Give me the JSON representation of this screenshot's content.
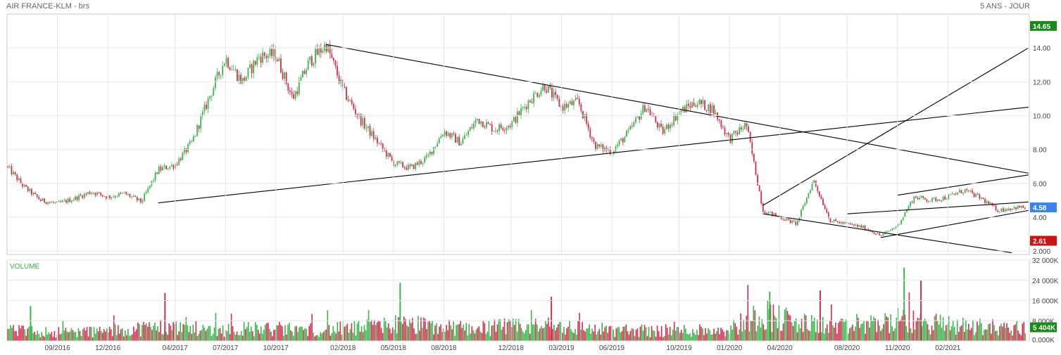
{
  "header": {
    "title": "AIR FRANCE-KLM - brs",
    "period": "5 ANS - JOUR"
  },
  "colors": {
    "up": "#3cb44b",
    "down": "#d03050",
    "high_badge": "#1a8a1a",
    "last_badge": "#3c82f0",
    "low_badge": "#cc1414",
    "vol_badge": "#1a8a1a",
    "grid": "#e6e6e6",
    "trendline": "#000000"
  },
  "chart_data": [
    {
      "type": "candlestick",
      "title": "AIR FRANCE-KLM - brs",
      "x_ticks": [
        "09/2016",
        "12/2016",
        "04/2017",
        "07/2017",
        "10/2017",
        "02/2018",
        "05/2018",
        "08/2018",
        "12/2018",
        "03/2019",
        "06/2019",
        "10/2019",
        "01/2020",
        "04/2020",
        "08/2020",
        "11/2020",
        "02/2021"
      ],
      "y_ticks": [
        "2.000",
        "4.00",
        "6.00",
        "8.00",
        "10.00",
        "12.00",
        "14.00"
      ],
      "ylim": [
        1.8,
        16.0
      ],
      "grid": true,
      "badges": {
        "high": "14.65",
        "last": "4.58",
        "low": "2.61"
      },
      "price_path": [
        [
          "2016-06",
          7.0
        ],
        [
          "2016-07",
          5.8
        ],
        [
          "2016-08",
          5.0
        ],
        [
          "2016-09",
          4.8
        ],
        [
          "2016-10",
          5.1
        ],
        [
          "2016-11",
          5.5
        ],
        [
          "2016-12",
          5.2
        ],
        [
          "2017-01",
          5.4
        ],
        [
          "2017-02",
          4.9
        ],
        [
          "2017-03",
          6.8
        ],
        [
          "2017-04",
          7.1
        ],
        [
          "2017-05",
          8.4
        ],
        [
          "2017-06",
          11.0
        ],
        [
          "2017-07",
          13.4
        ],
        [
          "2017-08",
          12.0
        ],
        [
          "2017-09",
          13.5
        ],
        [
          "2017-10",
          13.6
        ],
        [
          "2017-11",
          11.0
        ],
        [
          "2017-12",
          13.2
        ],
        [
          "2018-01",
          14.2
        ],
        [
          "2018-02",
          11.5
        ],
        [
          "2018-03",
          9.8
        ],
        [
          "2018-04",
          8.5
        ],
        [
          "2018-05",
          7.2
        ],
        [
          "2018-06",
          6.9
        ],
        [
          "2018-07",
          7.5
        ],
        [
          "2018-08",
          9.1
        ],
        [
          "2018-09",
          8.4
        ],
        [
          "2018-10",
          9.8
        ],
        [
          "2018-11",
          9.2
        ],
        [
          "2018-12",
          9.5
        ],
        [
          "2019-01",
          10.8
        ],
        [
          "2019-02",
          11.8
        ],
        [
          "2019-03",
          10.5
        ],
        [
          "2019-04",
          10.8
        ],
        [
          "2019-05",
          8.2
        ],
        [
          "2019-06",
          7.9
        ],
        [
          "2019-07",
          9.0
        ],
        [
          "2019-08",
          10.6
        ],
        [
          "2019-09",
          9.0
        ],
        [
          "2019-10",
          10.2
        ],
        [
          "2019-11",
          10.8
        ],
        [
          "2019-12",
          10.4
        ],
        [
          "2020-01",
          8.6
        ],
        [
          "2020-02",
          9.5
        ],
        [
          "2020-03",
          4.4
        ],
        [
          "2020-04",
          4.0
        ],
        [
          "2020-05",
          3.6
        ],
        [
          "2020-06",
          6.2
        ],
        [
          "2020-07",
          3.8
        ],
        [
          "2020-08",
          3.6
        ],
        [
          "2020-09",
          3.4
        ],
        [
          "2020-10",
          2.9
        ],
        [
          "2020-11",
          3.5
        ],
        [
          "2020-12",
          5.2
        ],
        [
          "2021-01",
          5.0
        ],
        [
          "2021-02",
          5.2
        ],
        [
          "2021-03",
          5.6
        ],
        [
          "2021-04",
          5.1
        ],
        [
          "2021-05",
          4.4
        ],
        [
          "2021-06",
          4.58
        ]
      ],
      "trendlines": [
        [
          [
            "2017-03",
            4.85
          ],
          [
            "2021-06",
            10.5
          ]
        ],
        [
          [
            "2018-01",
            14.2
          ],
          [
            "2021-06",
            6.6
          ]
        ],
        [
          [
            "2020-03",
            4.7
          ],
          [
            "2021-06",
            14.0
          ]
        ],
        [
          [
            "2020-03",
            4.2
          ],
          [
            "2021-05",
            1.9
          ]
        ],
        [
          [
            "2020-08",
            4.2
          ],
          [
            "2021-06",
            4.9
          ]
        ],
        [
          [
            "2020-10",
            2.8
          ],
          [
            "2021-06",
            4.4
          ]
        ],
        [
          [
            "2020-11",
            5.3
          ],
          [
            "2021-06",
            6.5
          ]
        ]
      ]
    },
    {
      "type": "bar",
      "label": "VOLUME",
      "y_ticks": [
        "0.000K",
        "8 000K",
        "16 000K",
        "24 000K",
        "32 000K"
      ],
      "ylim": [
        0,
        32000
      ],
      "units": "K",
      "badge": "5 404K",
      "badge_value": 5404,
      "volume_path": [
        [
          "2016-06",
          4000
        ],
        [
          "2016-09",
          3500
        ],
        [
          "2016-12",
          3800
        ],
        [
          "2017-03",
          5500
        ],
        [
          "2017-06",
          4500
        ],
        [
          "2017-09",
          4800
        ],
        [
          "2017-12",
          4300
        ],
        [
          "2018-03",
          5000
        ],
        [
          "2018-05",
          6500
        ],
        [
          "2018-08",
          5200
        ],
        [
          "2018-12",
          5400
        ],
        [
          "2019-03",
          5800
        ],
        [
          "2019-06",
          4200
        ],
        [
          "2019-10",
          4000
        ],
        [
          "2020-01",
          4800
        ],
        [
          "2020-03",
          11000
        ],
        [
          "2020-05",
          7000
        ],
        [
          "2020-08",
          5200
        ],
        [
          "2020-11",
          8000
        ],
        [
          "2021-02",
          6200
        ],
        [
          "2021-06",
          5000
        ]
      ],
      "volume_spikes": [
        [
          "2016-07",
          13800
        ],
        [
          "2017-03",
          19000
        ],
        [
          "2018-05",
          23000
        ],
        [
          "2019-02",
          17500
        ],
        [
          "2020-03",
          19500
        ],
        [
          "2020-06",
          20000
        ],
        [
          "2020-11",
          29000
        ],
        [
          "2020-12",
          24000
        ]
      ]
    }
  ]
}
